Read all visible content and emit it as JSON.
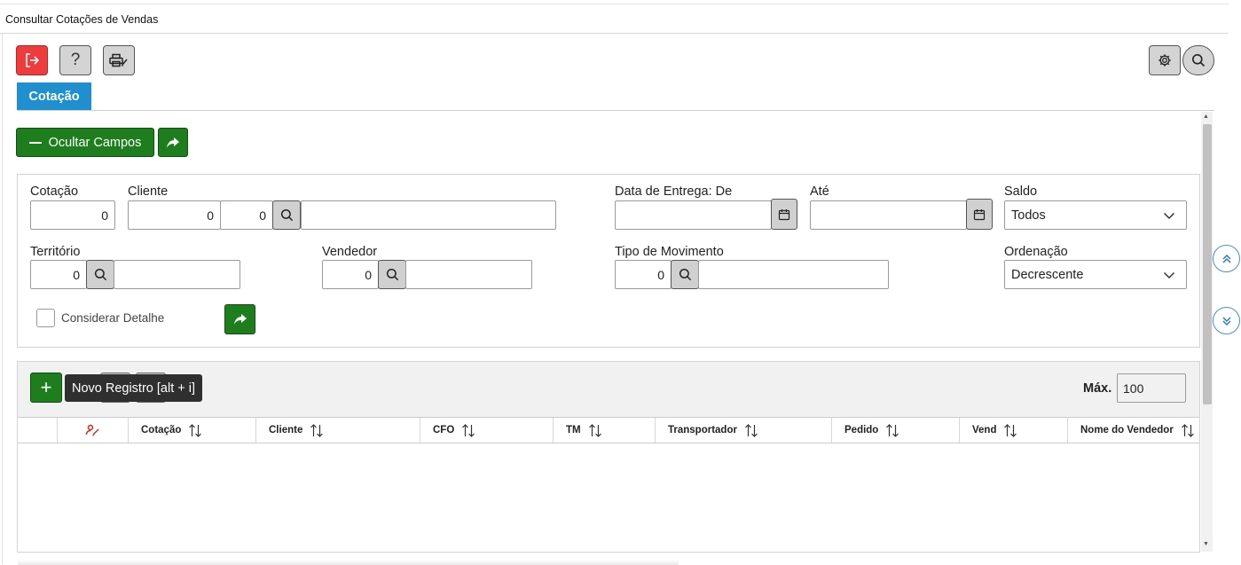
{
  "window": {
    "title": "Consultar Cotações de Vendas"
  },
  "toolbar": {
    "exit_icon": "exit-icon",
    "help_label": "?",
    "print_icon": "printer-edit-icon",
    "settings_icon": "gear-icon",
    "search_icon": "search-icon"
  },
  "tabs": [
    {
      "label": "Cotação",
      "active": true,
      "color": "#1f8fd0"
    }
  ],
  "actions": {
    "hide_fields_label": "Ocultar Campos"
  },
  "filters": {
    "cotacao": {
      "label": "Cotação",
      "value": "0"
    },
    "cliente": {
      "label": "Cliente",
      "value1": "0",
      "value2": "0",
      "name": ""
    },
    "data_entrega_de": {
      "label": "Data de Entrega: De",
      "value": ""
    },
    "ate": {
      "label": "Até",
      "value": ""
    },
    "saldo": {
      "label": "Saldo",
      "selected": "Todos"
    },
    "territorio": {
      "label": "Território",
      "value": "0",
      "name": ""
    },
    "vendedor": {
      "label": "Vendedor",
      "value": "0",
      "name": ""
    },
    "tipo_movimento": {
      "label": "Tipo de Movimento",
      "value": "0",
      "name": ""
    },
    "ordenacao": {
      "label": "Ordenação",
      "selected": "Decrescente"
    },
    "considerar_detalhe": {
      "label": "Considerar Detalhe",
      "checked": false
    }
  },
  "grid": {
    "tooltip": "Novo Registro [alt + i]",
    "max_label": "Máx.",
    "max_value": "100",
    "columns": [
      "Cotação",
      "Cliente",
      "CFO",
      "TM",
      "Transportador",
      "Pedido",
      "Vend",
      "Nome do Vendedor"
    ],
    "rows": []
  },
  "colors": {
    "primary_green": "#1e7e1e",
    "exit_red": "#ee3b3b",
    "tab_blue": "#1f8fd0"
  }
}
